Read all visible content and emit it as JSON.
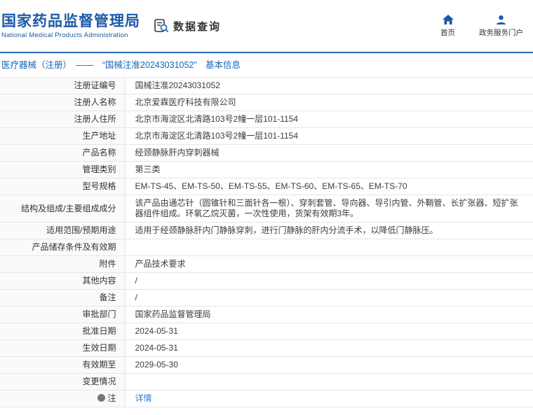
{
  "header": {
    "logo_title": "国家药品监督管理局",
    "logo_subtitle": "National Medical Products Administration",
    "section_title": "数据查询",
    "nav": [
      {
        "label": "首页",
        "icon": "home-icon"
      },
      {
        "label": "政务服务门户",
        "icon": "user-icon"
      }
    ]
  },
  "breadcrumb": {
    "text": "医疗器械（注册）　——　“国械注准20243031052”　基本信息"
  },
  "table": {
    "rows": [
      {
        "label": "注册证编号",
        "value": "国械注准20243031052"
      },
      {
        "label": "注册人名称",
        "value": "北京爱霖医疗科技有限公司"
      },
      {
        "label": "注册人住所",
        "value": "北京市海淀区北清路103号2幢一层101-1154"
      },
      {
        "label": "生产地址",
        "value": "北京市海淀区北清路103号2幢一层101-1154"
      },
      {
        "label": "产品名称",
        "value": "经颈静脉肝内穿刺器械"
      },
      {
        "label": "管理类别",
        "value": "第三类"
      },
      {
        "label": "型号规格",
        "value": "EM-TS-45、EM-TS-50、EM-TS-55、EM-TS-60、EM-TS-65、EM-TS-70"
      },
      {
        "label": "结构及组成/主要组成成分",
        "value": "该产品由通芯针（圆锥针和三面针各一根）、穿刺套管、导向器、导引内管、外鞘管、长扩张器、短扩张器组件组成。环氧乙烷灭菌，一次性使用，货架有效期3年。"
      },
      {
        "label": "适用范围/预期用途",
        "value": "适用于经颈静脉肝内门静脉穿刺，进行门静脉的肝内分流手术，以降低门静脉压。"
      },
      {
        "label": "产品储存条件及有效期",
        "value": ""
      },
      {
        "label": "附件",
        "value": "产品技术要求"
      },
      {
        "label": "其他内容",
        "value": "/"
      },
      {
        "label": "备注",
        "value": "/"
      },
      {
        "label": "审批部门",
        "value": "国家药品监督管理局"
      },
      {
        "label": "批准日期",
        "value": "2024-05-31"
      },
      {
        "label": "生效日期",
        "value": "2024-05-31"
      },
      {
        "label": "有效期至",
        "value": "2029-05-30"
      },
      {
        "label": "变更情况",
        "value": ""
      },
      {
        "label": "注",
        "value": "详情",
        "link": true,
        "icon": "note-icon"
      }
    ]
  },
  "colors": {
    "brand_blue": "#1b5aa8",
    "divider_blue": "#2b6cb8",
    "breadcrumb_blue": "#1766b5",
    "link_blue": "#2e7ecb",
    "row_border": "#e6e6e6",
    "label_bg": "#fafafa"
  }
}
